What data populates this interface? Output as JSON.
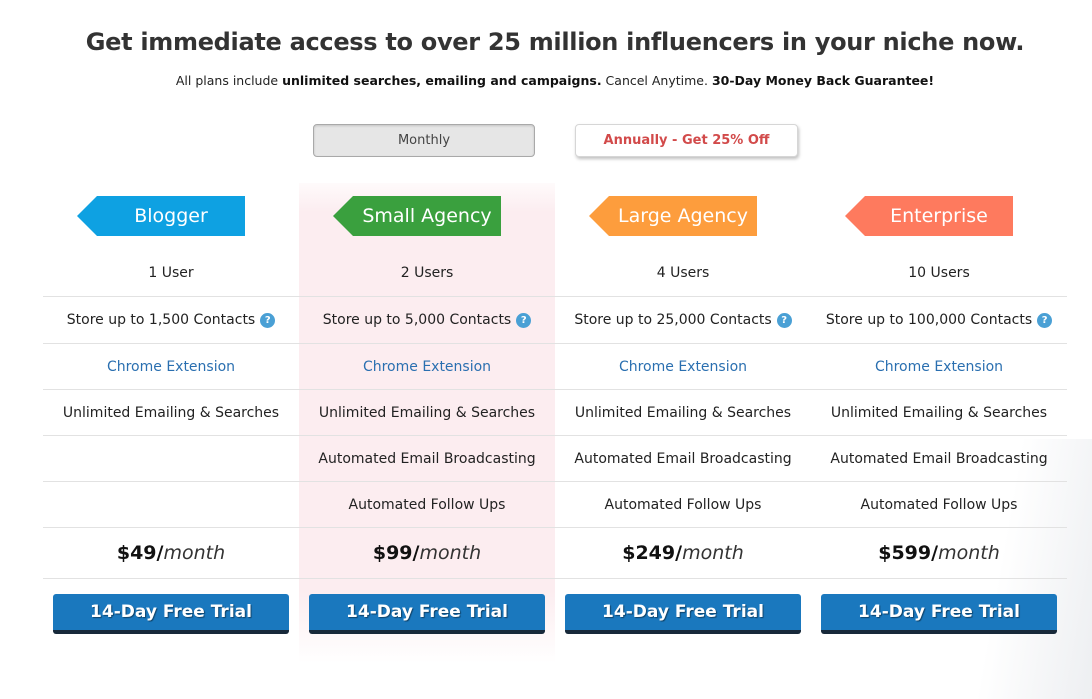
{
  "headline": "Get immediate access to over 25 million influencers in your niche now.",
  "subline": {
    "part1": "All plans include ",
    "bold1": "unlimited searches, emailing and campaigns.",
    "part2": " Cancel Anytime. ",
    "bold2": "30-Day Money Back Guarantee!"
  },
  "billing_toggle": {
    "monthly_label": "Monthly",
    "annual_label": "Annually - Get 25% Off",
    "selected": "Monthly"
  },
  "colors": {
    "blogger": "#0ea1e2",
    "small_agency": "#3aa03e",
    "large_agency": "#fd9d3d",
    "enterprise": "#fe7a5e",
    "cta": "#1a78be",
    "link": "#2a6fb0",
    "annual_text": "#d24a4a",
    "highlight": "#fcedf0"
  },
  "plans": [
    {
      "name": "Blogger",
      "users": "1 User",
      "contacts": "Store up to 1,500 Contacts",
      "chrome": "Chrome Extension",
      "unlimited": "Unlimited Emailing & Searches",
      "broadcasting": "",
      "followups": "",
      "price": "$49",
      "slash": " /",
      "period": "month",
      "cta": "14-Day Free Trial"
    },
    {
      "name": "Small Agency",
      "users": "2 Users",
      "contacts": "Store up to 5,000 Contacts",
      "chrome": "Chrome Extension",
      "unlimited": "Unlimited Emailing & Searches",
      "broadcasting": "Automated Email Broadcasting",
      "followups": "Automated Follow Ups",
      "price": "$99",
      "slash": " /",
      "period": "month",
      "cta": "14-Day Free Trial",
      "highlighted": true
    },
    {
      "name": "Large Agency",
      "users": "4 Users",
      "contacts": "Store up to 25,000 Contacts",
      "chrome": "Chrome Extension",
      "unlimited": "Unlimited Emailing & Searches",
      "broadcasting": "Automated Email Broadcasting",
      "followups": "Automated Follow Ups",
      "price": "$249",
      "slash": " /",
      "period": "month",
      "cta": "14-Day Free Trial"
    },
    {
      "name": "Enterprise",
      "users": "10 Users",
      "contacts": "Store up to 100,000 Contacts",
      "chrome": "Chrome Extension",
      "unlimited": "Unlimited Emailing & Searches",
      "broadcasting": "Automated Email Broadcasting",
      "followups": "Automated Follow Ups",
      "price": "$599",
      "slash": " /",
      "period": "month",
      "cta": "14-Day Free Trial"
    }
  ],
  "help_icon_glyph": "?"
}
